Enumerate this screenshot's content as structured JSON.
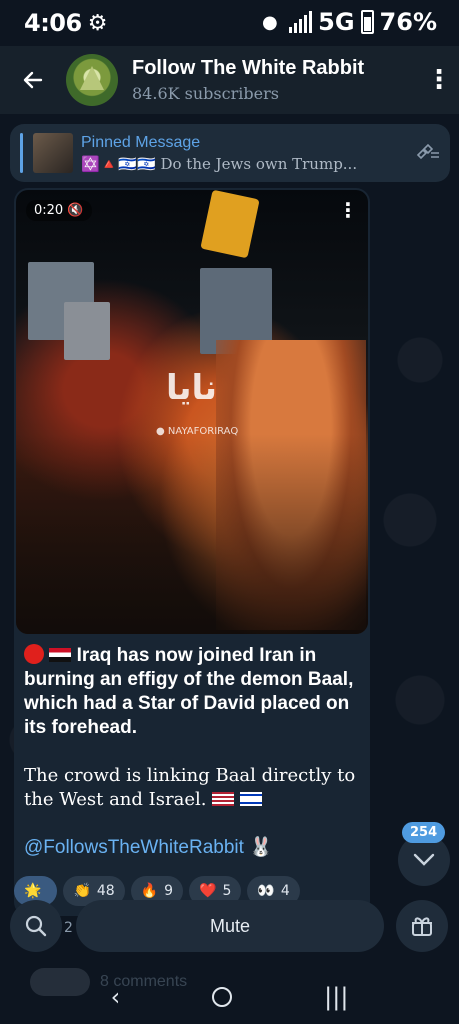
{
  "status": {
    "time": "4:06",
    "network": "5G",
    "battery": "76%"
  },
  "header": {
    "title": "Follow The White Rabbit",
    "subtitle": "84.6K subscribers"
  },
  "pinned": {
    "title": "Pinned Message",
    "snippet": "✡️🔺🇮🇱🇮🇱 Do the Jews own Trump..."
  },
  "video": {
    "duration": "0:20",
    "watermark": "نايا",
    "watermark_sub": "● NAYAFORIRAQ"
  },
  "message": {
    "paragraph1": "Iraq has now joined Iran in burning an effigy of the demon Baal, which had a Star of David placed on its forehead.",
    "paragraph2": "The crowd is linking Baal directly to the West and Israel.",
    "handle": "@FollowsTheWhiteRabbit 🐰"
  },
  "reactions": [
    {
      "emoji": "🌟",
      "count": ""
    },
    {
      "emoji": "👏",
      "count": "48"
    },
    {
      "emoji": "🔥",
      "count": "9"
    },
    {
      "emoji": "❤️",
      "count": "5"
    },
    {
      "emoji": "👀",
      "count": "4"
    }
  ],
  "fab": {
    "unread": "254"
  },
  "bottom": {
    "search_count": "2",
    "mute_label": "Mute",
    "comments": "8 comments"
  },
  "icons": {
    "back": "arrow-left-icon",
    "menu": "more-vert-icon",
    "pin": "pin-list-icon",
    "search": "search-icon",
    "gift": "gift-icon",
    "down": "chevron-down-icon"
  },
  "colors": {
    "accent": "#5ea3e6",
    "link": "#6ab2f2",
    "background": "#0e1621",
    "bubble": "#182533"
  }
}
